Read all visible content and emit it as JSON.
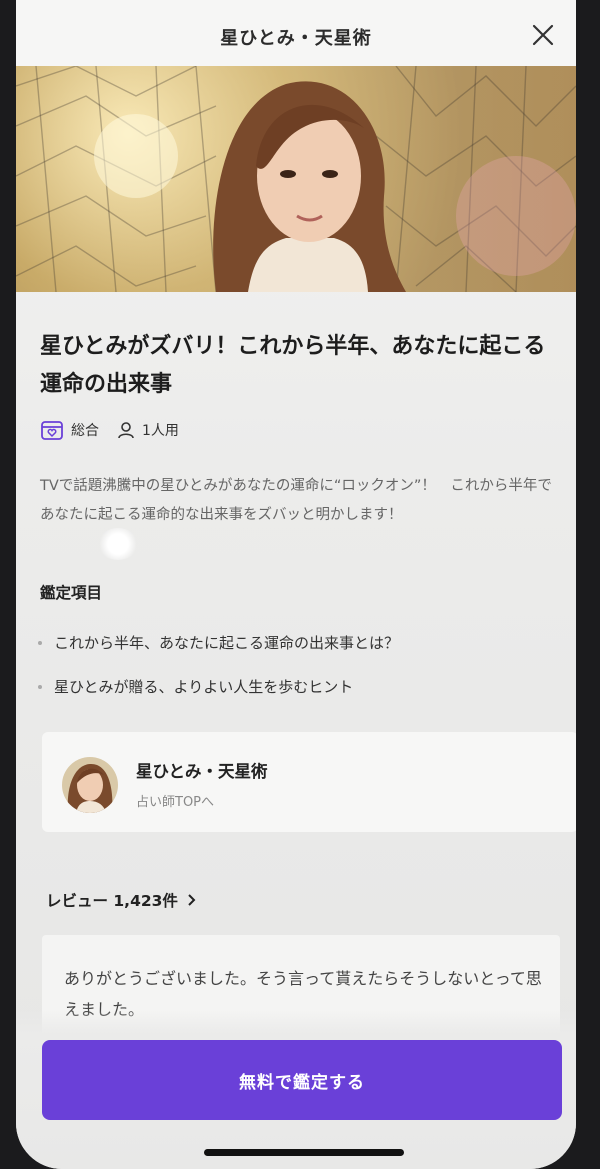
{
  "header": {
    "title": "星ひとみ・天星術"
  },
  "menu": {
    "title": "星ひとみがズバリ！これから半年、あなたに起こる運命の出来事",
    "category_icon": "gift-box-icon",
    "category": "総合",
    "people_icon": "person-icon",
    "people": "1人用",
    "description": "TVで話題沸騰中の星ひとみがあなたの運命に“ロックオン”！　これから半年であなたに起こる運命的な出来事をズバッと明かします！"
  },
  "items": {
    "heading": "鑑定項目",
    "list": [
      "これから半年、あなたに起こる運命の出来事とは？",
      "星ひとみが贈る、よりよい人生を歩むヒント"
    ]
  },
  "fortune_teller": {
    "name": "星ひとみ・天星術",
    "link": "占い師TOPへ"
  },
  "reviews": {
    "link": "レビュー 1,423件",
    "first_review": "ありがとうございました。そう言って貰えたらそうしないとって思えました。"
  },
  "cta": {
    "label": "無料で鑑定する"
  },
  "colors": {
    "accent": "#6a40d8",
    "background": "#ececeb"
  }
}
